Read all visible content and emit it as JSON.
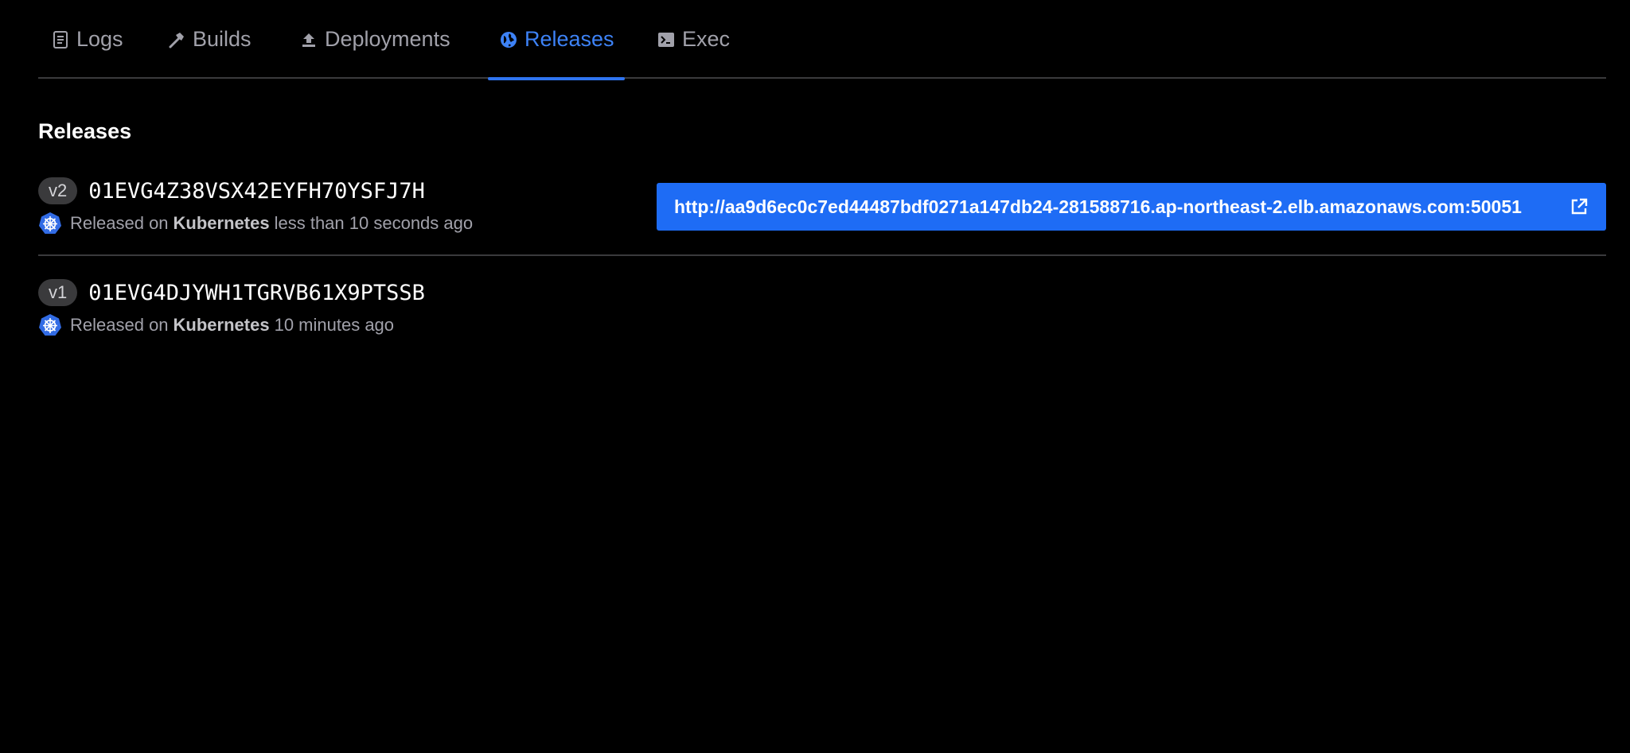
{
  "tabs": [
    {
      "label": "Logs",
      "icon": "document-icon",
      "active": false
    },
    {
      "label": "Builds",
      "icon": "hammer-icon",
      "active": false
    },
    {
      "label": "Deployments",
      "icon": "upload-icon",
      "active": false
    },
    {
      "label": "Releases",
      "icon": "globe-icon",
      "active": true
    },
    {
      "label": "Exec",
      "icon": "terminal-icon",
      "active": false
    }
  ],
  "section": {
    "title": "Releases"
  },
  "releases": [
    {
      "version": "v2",
      "id": "01EVG4Z38VSX42EYFH70YSFJ7H",
      "released_prefix": "Released on",
      "platform": "Kubernetes",
      "time": "less than 10 seconds ago",
      "url": "http://aa9d6ec0c7ed44487bdf0271a147db24-281588716.ap-northeast-2.elb.amazonaws.com:50051"
    },
    {
      "version": "v1",
      "id": "01EVG4DJYWH1TGRVB61X9PTSSB",
      "released_prefix": "Released on",
      "platform": "Kubernetes",
      "time": "10 minutes ago"
    }
  ],
  "colors": {
    "background": "#000000",
    "accent": "#1e6cf5",
    "active_tab": "#3d82f6",
    "muted_text": "#a1a1aa",
    "kubernetes": "#326ce5"
  }
}
